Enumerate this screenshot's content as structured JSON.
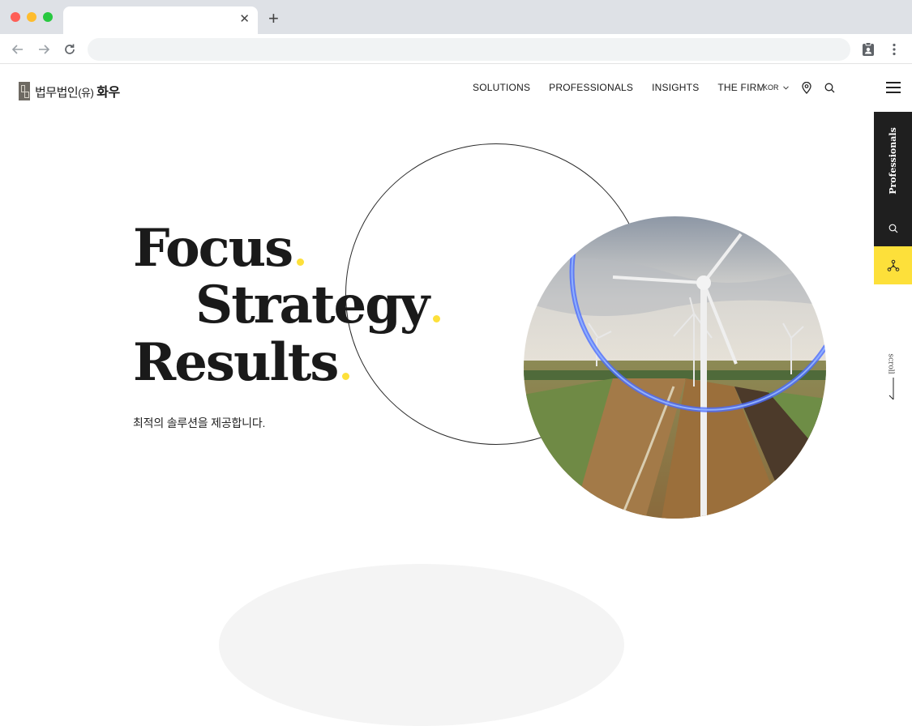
{
  "browser": {
    "tab_title": "",
    "tab_close": "✕",
    "new_tab": "+",
    "address": ""
  },
  "header": {
    "logo_part1": "법무법인",
    "logo_part2": "(유)",
    "logo_part3": " 화우",
    "nav": [
      "SOLUTIONS",
      "PROFESSIONALS",
      "INSIGHTS",
      "THE FIRM"
    ],
    "lang": "KOR"
  },
  "rail": {
    "label": "Professionals",
    "scroll": "scroll"
  },
  "hero": {
    "line1": "Focus",
    "line2": "Strategy",
    "line3": "Results",
    "subtitle": "최적의 솔루션을 제공합니다."
  },
  "colors": {
    "accent": "#fde03a",
    "dark": "#1f1f1f",
    "text": "#1a1a1a"
  },
  "icons": {
    "back": "arrow-left-icon",
    "forward": "arrow-right-icon",
    "reload": "reload-icon",
    "extension": "clipboard-icon",
    "menu": "kebab-menu-icon",
    "location": "map-pin-icon",
    "search": "search-icon",
    "hamburger": "hamburger-icon",
    "network": "network-nodes-icon"
  }
}
